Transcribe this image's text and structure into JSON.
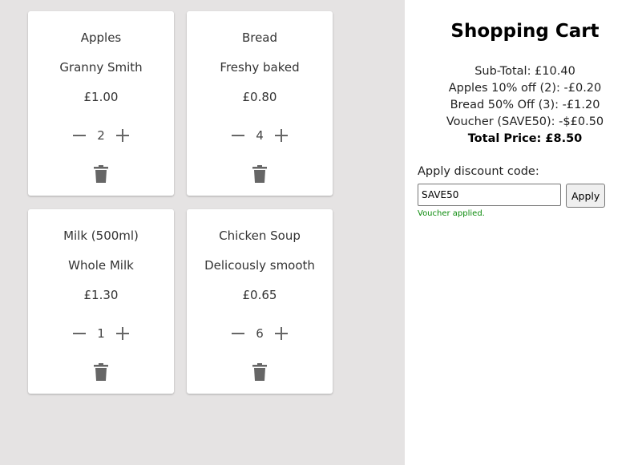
{
  "products": [
    {
      "name": "Apples",
      "description": "Granny Smith",
      "price": "£1.00",
      "quantity": "2"
    },
    {
      "name": "Bread",
      "description": "Freshy baked",
      "price": "£0.80",
      "quantity": "4"
    },
    {
      "name": "Milk (500ml)",
      "description": "Whole Milk",
      "price": "£1.30",
      "quantity": "1"
    },
    {
      "name": "Chicken Soup",
      "description": "Delicously smooth",
      "price": "£0.65",
      "quantity": "6"
    }
  ],
  "cart": {
    "title": "Shopping Cart",
    "lines": [
      "Sub-Total: £10.40",
      "Apples 10% off (2): -£0.20",
      "Bread 50% Off (3): -£1.20",
      "Voucher (SAVE50): -$£0.50"
    ],
    "total": "Total Price: £8.50",
    "discount": {
      "label": "Apply discount code:",
      "value": "SAVE50",
      "button_label": "Apply",
      "status": "Voucher applied."
    }
  },
  "icons": {
    "decrease": "minus-icon",
    "increase": "plus-icon",
    "remove": "trash-icon"
  },
  "colors": {
    "product_area_bg": "#e5e3e3",
    "icon": "#666666",
    "status_success": "#0a8a0a"
  }
}
